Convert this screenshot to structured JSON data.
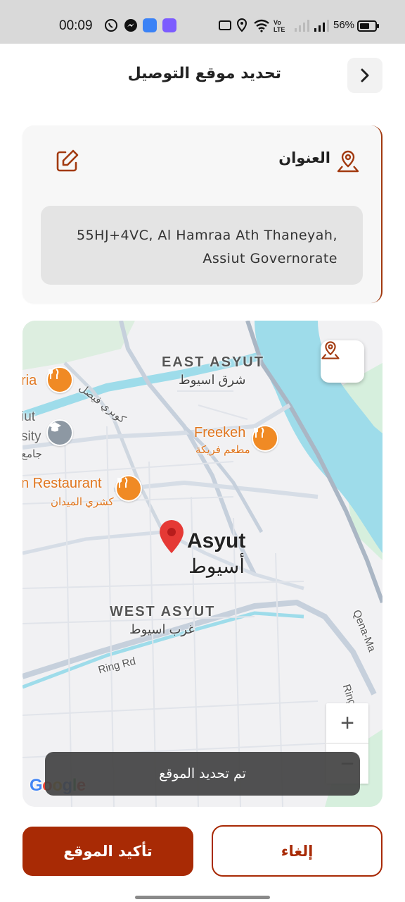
{
  "status_bar": {
    "time": "00:09",
    "battery": "56%",
    "network_label": "Vo LTE"
  },
  "header": {
    "title": "تحديد موقع التوصيل",
    "back_icon": "chevron-right-icon"
  },
  "address_card": {
    "title": "العنوان",
    "pin_icon": "map-pin-icon",
    "edit_icon": "edit-icon",
    "address_line1": "55HJ+4VC, Al Hamraa Ath Thaneyah,",
    "address_line2": "Assiut Governorate",
    "accent_color": "#a23a10"
  },
  "map": {
    "city_en": "Asyut",
    "city_ar": "أسيوط",
    "east_en": "EAST ASYUT",
    "east_ar": "شرق اسيوط",
    "west_en": "WEST ASYUT",
    "west_ar": "غرب اسيوط",
    "poi_freekeh_en": "Freekeh",
    "poi_freekeh_ar": "مطعم فريكة",
    "poi_restaurant_en": "n Restaurant",
    "poi_restaurant_ar": "كشري الميدان",
    "poi_left_en": "ria",
    "uni_line1": "iut",
    "uni_line2": "sity",
    "uni_ar": "جامع",
    "road_ring": "Ring Rd",
    "road_ring2": "Ring Rd",
    "road_koubry": "كوبري فيصل",
    "road_qena": "Qena-Ma",
    "zoom_in": "+",
    "zoom_out": "−",
    "google": [
      "G",
      "o",
      "o",
      "g",
      "l",
      "e"
    ],
    "marker_color": "#e53935",
    "water_color": "#9edcea"
  },
  "toast": {
    "text": "تم تحديد الموقع"
  },
  "actions": {
    "confirm_label": "تأكيد الموقع",
    "cancel_label": "إلغاء",
    "primary_color": "#a82a05"
  }
}
